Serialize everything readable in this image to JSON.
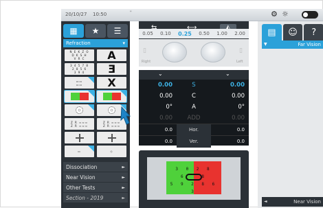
{
  "status": {
    "date": "20/10/27",
    "time": "10:50",
    "tick": "\""
  },
  "left": {
    "section_title": "Refraction",
    "menu": [
      {
        "label": "Dissociation"
      },
      {
        "label": "Near Vision"
      },
      {
        "label": "Other Tests"
      },
      {
        "label": "Section - 2019"
      }
    ],
    "glyphs": {
      "a": "A",
      "e3": "Ǝ",
      "x": "X",
      "z": "Z R"
    }
  },
  "center": {
    "sph_steps": [
      "0.05",
      "0.10",
      "0.25",
      "0.50",
      "1.00",
      "2.00"
    ],
    "active_step": "0.25",
    "phoro_left": "Right",
    "phoro_right": "Left",
    "table": {
      "rows": [
        {
          "left": "0.00",
          "key": "S",
          "right": "0.00",
          "style": "blue"
        },
        {
          "left": "0.00",
          "key": "C",
          "right": "0.00",
          "style": ""
        },
        {
          "left": "0°",
          "key": "A",
          "right": "0°",
          "style": ""
        },
        {
          "left": "0.00",
          "key": "ADD",
          "right": "0.00",
          "style": "dim"
        }
      ],
      "prism": [
        {
          "left": "0.0",
          "key": "Hor.",
          "right": "0.0"
        },
        {
          "left": "0.0",
          "key": "Ver.",
          "right": "0.0"
        }
      ]
    },
    "chart_text": "3 0  2 8\n6  8  \n5 9 2 8 6 3"
  },
  "right": {
    "header": "Far Vision",
    "footer": "Near Vision"
  },
  "colors": {
    "accent": "#2ba1d9",
    "panel": "#2b3137",
    "green": "#4fd13b",
    "red": "#e8332f"
  }
}
